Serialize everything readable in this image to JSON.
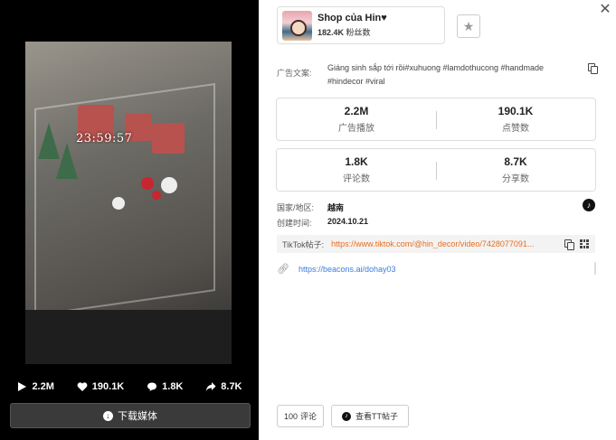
{
  "video": {
    "timer": "23:59:57",
    "stats": {
      "plays": "2.2M",
      "likes": "190.1K",
      "comments": "1.8K",
      "shares": "8.7K"
    },
    "download_label": "下载媒体"
  },
  "shop": {
    "name": "Shop của Hin♥",
    "fans_count": "182.4K",
    "fans_label": "粉丝数"
  },
  "caption": {
    "label": "广告文案:",
    "text": "Giáng sinh sắp tới rồi#xuhuong #lamdothucong #handmade #hindecor #viral"
  },
  "metrics": {
    "plays": {
      "value": "2.2M",
      "label": "广告播放"
    },
    "likes": {
      "value": "190.1K",
      "label": "点赞数"
    },
    "comments": {
      "value": "1.8K",
      "label": "评论数"
    },
    "shares": {
      "value": "8.7K",
      "label": "分享数"
    }
  },
  "info": {
    "country_label": "国家/地区:",
    "country_value": "越南",
    "created_label": "创建时间:",
    "created_value": "2024.10.21"
  },
  "tiktok": {
    "label": "TikTok帖子:",
    "url": "https://www.tiktok.com/@hin_decor/video/7428077091..."
  },
  "external_link": "https://beacons.ai/dohay03",
  "buttons": {
    "comments_count": "100",
    "comments_label": "评论",
    "view_tt_label": "查看TT帖子"
  },
  "icons": {
    "close": "close-icon",
    "star": "star-icon",
    "copy": "copy-icon",
    "tiktok": "tiktok-icon",
    "qr": "qr-code-icon",
    "link": "link-icon",
    "play": "play-icon",
    "heart": "heart-icon",
    "comment": "comment-icon",
    "share": "share-icon",
    "download": "download-icon"
  },
  "colors": {
    "link_orange": "#e76f1f",
    "link_blue": "#3b7ddd"
  }
}
